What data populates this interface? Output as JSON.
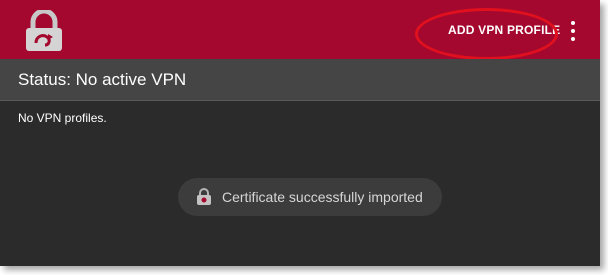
{
  "appbar": {
    "icon": "lock-icon",
    "add_profile_label": "ADD VPN PROFILE",
    "overflow_icon": "more-vertical-icon",
    "brand_color": "#a4082e"
  },
  "status": {
    "text": "Status: No active VPN"
  },
  "profiles": {
    "empty_text": "No VPN profiles."
  },
  "toast": {
    "icon": "lock-icon",
    "message": "Certificate successfully imported"
  },
  "annotation": {
    "highlight_color": "#e0101e"
  }
}
